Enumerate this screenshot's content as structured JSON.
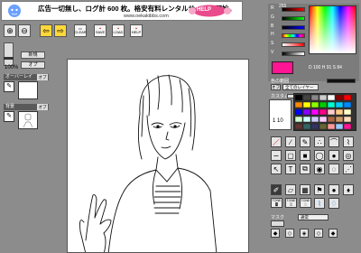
{
  "banner": {
    "headline": "広告一切無し、ログ計 600 枚。格安有料レンタルサービス開始。",
    "url": "www.oekakibbs.com",
    "help_label": "HELP"
  },
  "toolbar": {
    "clear_label": "CLEAR",
    "save_label": "SAVE",
    "load_label": "LOAD",
    "help_label": "HELP"
  },
  "left_panel": {
    "zoom_value": "100%",
    "button_1": "新規",
    "button_2": "オプ",
    "layer_1": {
      "name": "オーバーレイ",
      "option": "オプ"
    },
    "layer_2": {
      "name": "背景",
      "option": "オプ"
    }
  },
  "color_panel": {
    "r_value": "255",
    "g_value": "0",
    "b_value": "0",
    "h_value": "0",
    "s_value": "84",
    "v_value": "100",
    "hsv_line": "D 100 H 91 S 84",
    "current_color": "#ff1493",
    "secondary_color": "#808080"
  },
  "brush_panel": {
    "mode_label": "色の範囲",
    "opacity_label": "オフ",
    "layer_scope": "全てのレイヤー",
    "custom_label": "カスタム",
    "size_label": "1",
    "size_value": "10"
  },
  "bottom": {
    "mask_label": "マスク",
    "mask_mode": "通常"
  },
  "colors": {
    "accent": "#ff1493",
    "background": "#8c8c8c"
  }
}
